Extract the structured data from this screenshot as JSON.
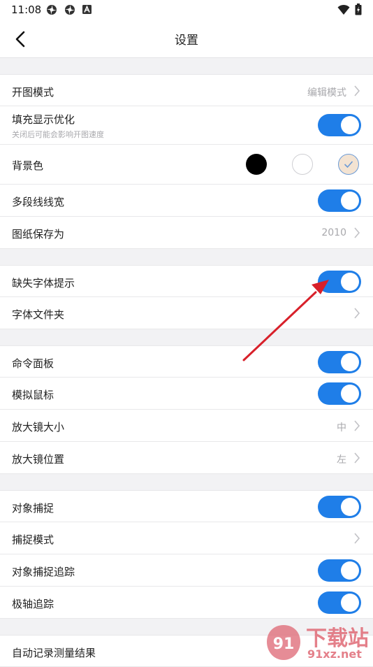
{
  "status_bar": {
    "time": "11:08"
  },
  "header": {
    "title": "设置"
  },
  "sections": [
    {
      "items": [
        {
          "label": "开图模式",
          "value": "编辑模式"
        },
        {
          "label": "填充显示优化",
          "sub": "关闭后可能会影响开图速度",
          "toggle": true
        },
        {
          "label": "背景色",
          "selected": "white"
        },
        {
          "label": "多段线线宽",
          "toggle": true
        },
        {
          "label": "图纸保存为",
          "value": "2010"
        }
      ]
    },
    {
      "items": [
        {
          "label": "缺失字体提示",
          "toggle": true
        },
        {
          "label": "字体文件夹"
        }
      ]
    },
    {
      "items": [
        {
          "label": "命令面板",
          "toggle": true
        },
        {
          "label": "模拟鼠标",
          "toggle": true
        },
        {
          "label": "放大镜大小",
          "value": "中"
        },
        {
          "label": "放大镜位置",
          "value": "左"
        }
      ]
    },
    {
      "items": [
        {
          "label": "对象捕捉",
          "toggle": true
        },
        {
          "label": "捕捉模式"
        },
        {
          "label": "对象捕捉追踪",
          "toggle": true
        },
        {
          "label": "极轴追踪",
          "toggle": true
        }
      ]
    },
    {
      "items": [
        {
          "label": "自动记录测量结果"
        }
      ]
    }
  ],
  "colors": {
    "toggle_on": "#1f7ee8",
    "annotation_arrow": "#d8202a"
  },
  "watermark": {
    "text_cn": "下载站",
    "text_domain": "91xz.net",
    "logo": "91"
  }
}
